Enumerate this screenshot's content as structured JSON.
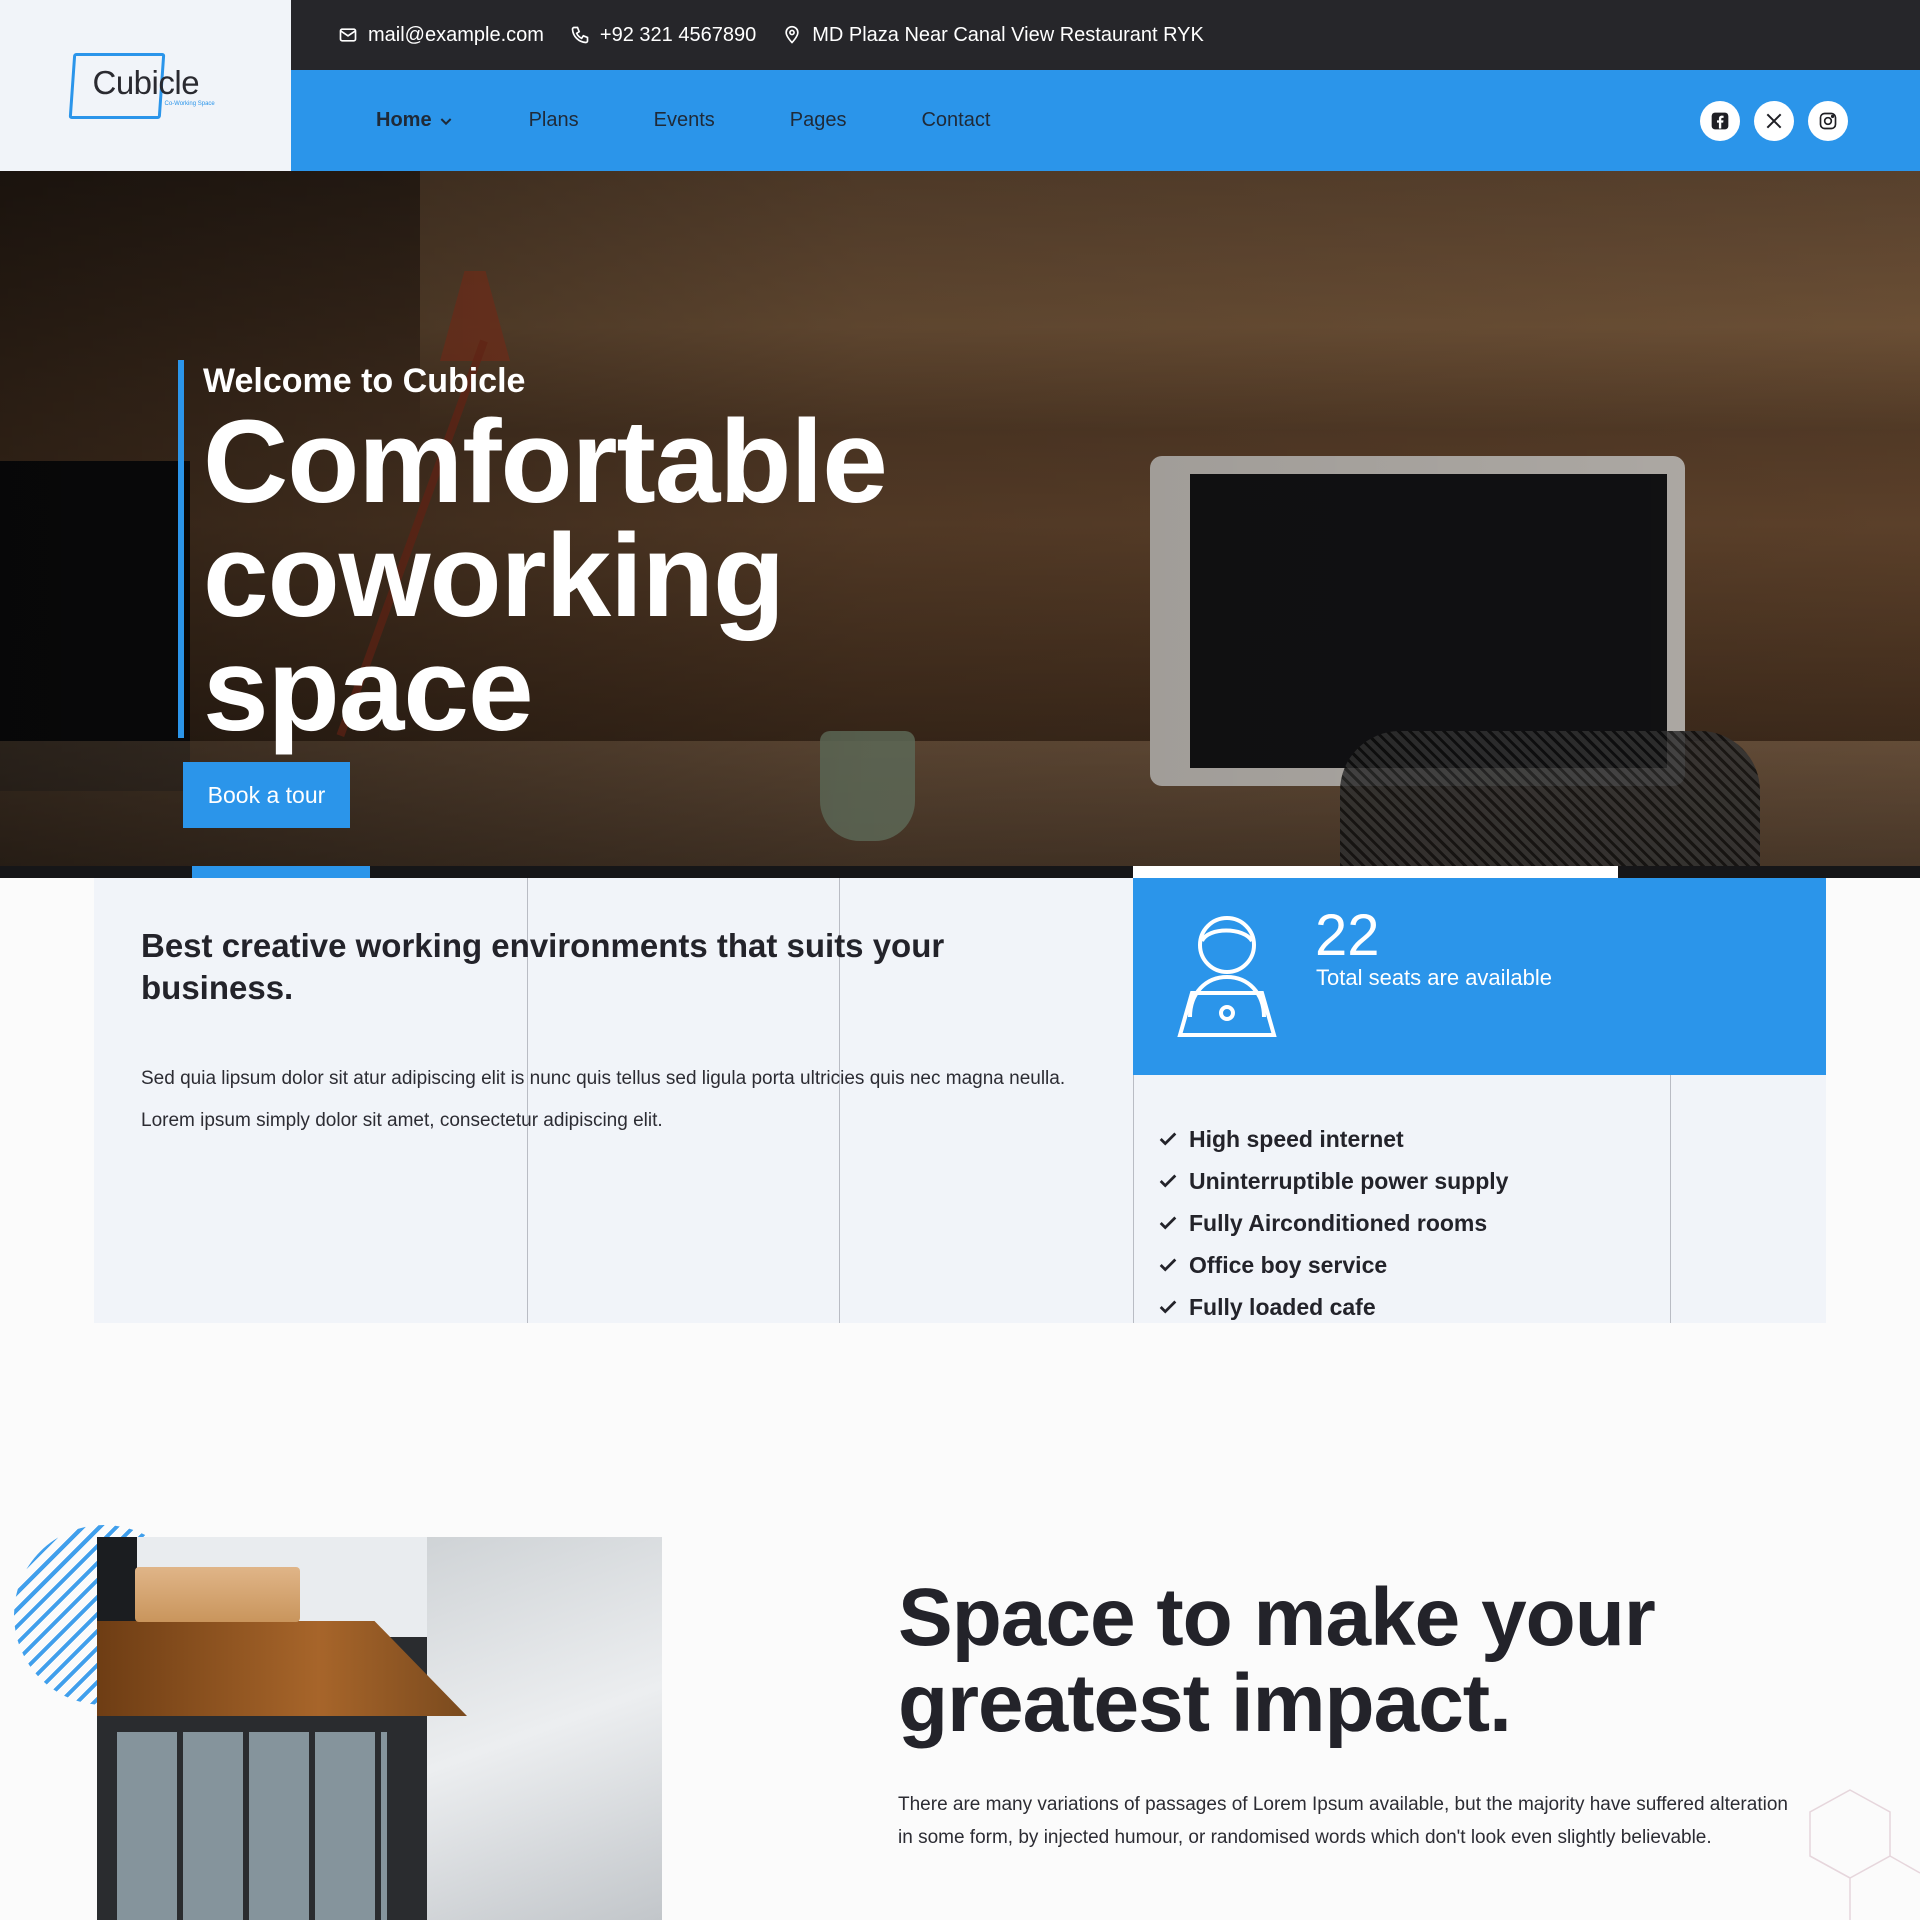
{
  "brand": {
    "name": "Cubicle",
    "tagline": "Co-Working Space"
  },
  "topbar": {
    "email": "mail@example.com",
    "phone": "+92 321 4567890",
    "address": "MD Plaza Near Canal View Restaurant RYK"
  },
  "nav": {
    "items": [
      {
        "label": "Home",
        "active": true,
        "has_dropdown": true
      },
      {
        "label": "Plans"
      },
      {
        "label": "Events"
      },
      {
        "label": "Pages"
      },
      {
        "label": "Contact"
      }
    ],
    "socials": [
      "facebook-icon",
      "x-icon",
      "instagram-icon"
    ]
  },
  "hero": {
    "eyebrow": "Welcome to Cubicle",
    "title": "Comfortable coworking space",
    "cta": "Book a tour"
  },
  "feature": {
    "title": "Best creative working environments that suits your business.",
    "text": "Sed quia lipsum dolor sit atur adipiscing elit is nunc quis tellus sed ligula porta ultricies quis nec magna neulla. Lorem ipsum simply dolor sit amet, consectetur adipiscing elit.",
    "seats": {
      "count": "22",
      "label": "Total seats are available"
    },
    "list": [
      "High speed internet",
      "Uninterruptible power supply",
      "Fully Airconditioned rooms",
      "Office boy service",
      "Fully loaded cafe"
    ]
  },
  "about": {
    "title": "Space to make your greatest impact.",
    "text": "There are many variations of passages of Lorem Ipsum available, but the majority have suffered alteration in some form, by injected humour, or randomised words which don't look even slightly believable."
  },
  "colors": {
    "accent": "#2b95ea",
    "dark": "#26262a",
    "light_bg": "#f1f4f9"
  }
}
